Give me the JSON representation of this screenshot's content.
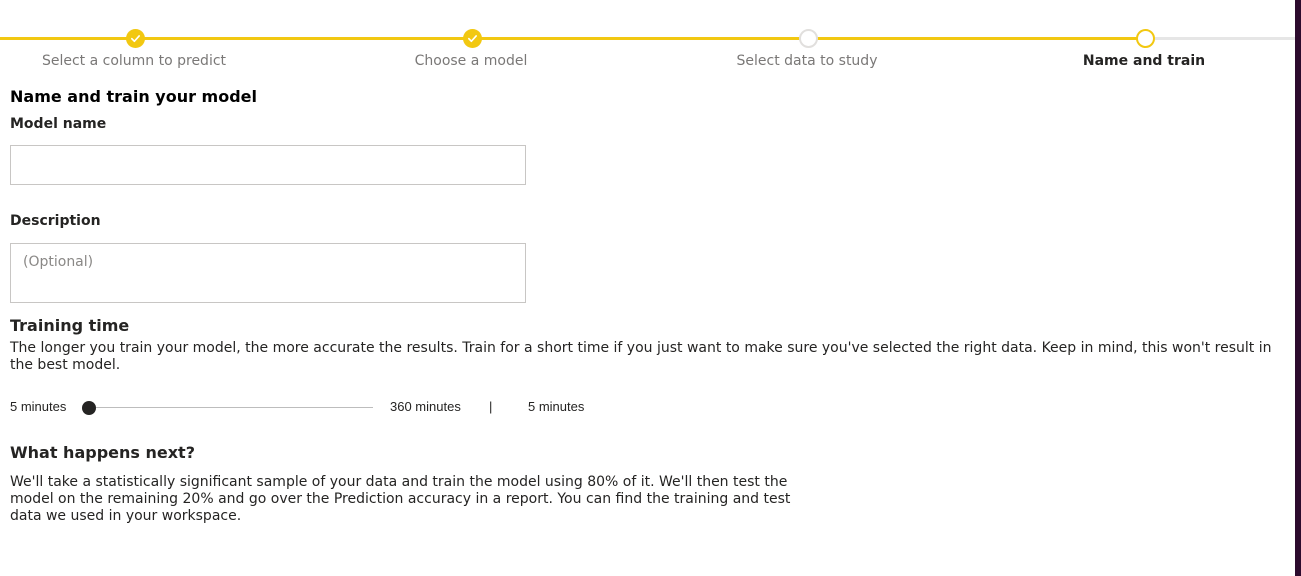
{
  "stepper": {
    "steps": [
      {
        "label": "Select a column to predict",
        "state": "complete"
      },
      {
        "label": "Choose a model",
        "state": "complete"
      },
      {
        "label": "Select data to study",
        "state": "pending"
      },
      {
        "label": "Name and train",
        "state": "current"
      }
    ]
  },
  "form": {
    "title": "Name and train your model",
    "model_name_label": "Model name",
    "model_name_value": "",
    "description_label": "Description",
    "description_placeholder": "(Optional)",
    "training_time": {
      "title": "Training time",
      "text": "The longer you train your model, the more accurate the results. Train for a short time if you just want to make sure you've selected the right data. Keep in mind, this won't result in the best model.",
      "min_label": "5 minutes",
      "max_label": "360 minutes",
      "separator": "|",
      "current_label": "5 minutes",
      "min": 5,
      "max": 360,
      "value": 5
    },
    "next": {
      "title": "What happens next?",
      "text": "We'll take a statistically significant sample of your data and train the model using 80% of it. We'll then test the model on the remaining 20% and go over the Prediction accuracy in a report. You can find the training and test data we used in your workspace."
    }
  },
  "colors": {
    "accent": "#f2c811",
    "text": "#252423",
    "border": "#c8c6c4",
    "edge": "#2d0b2e"
  }
}
